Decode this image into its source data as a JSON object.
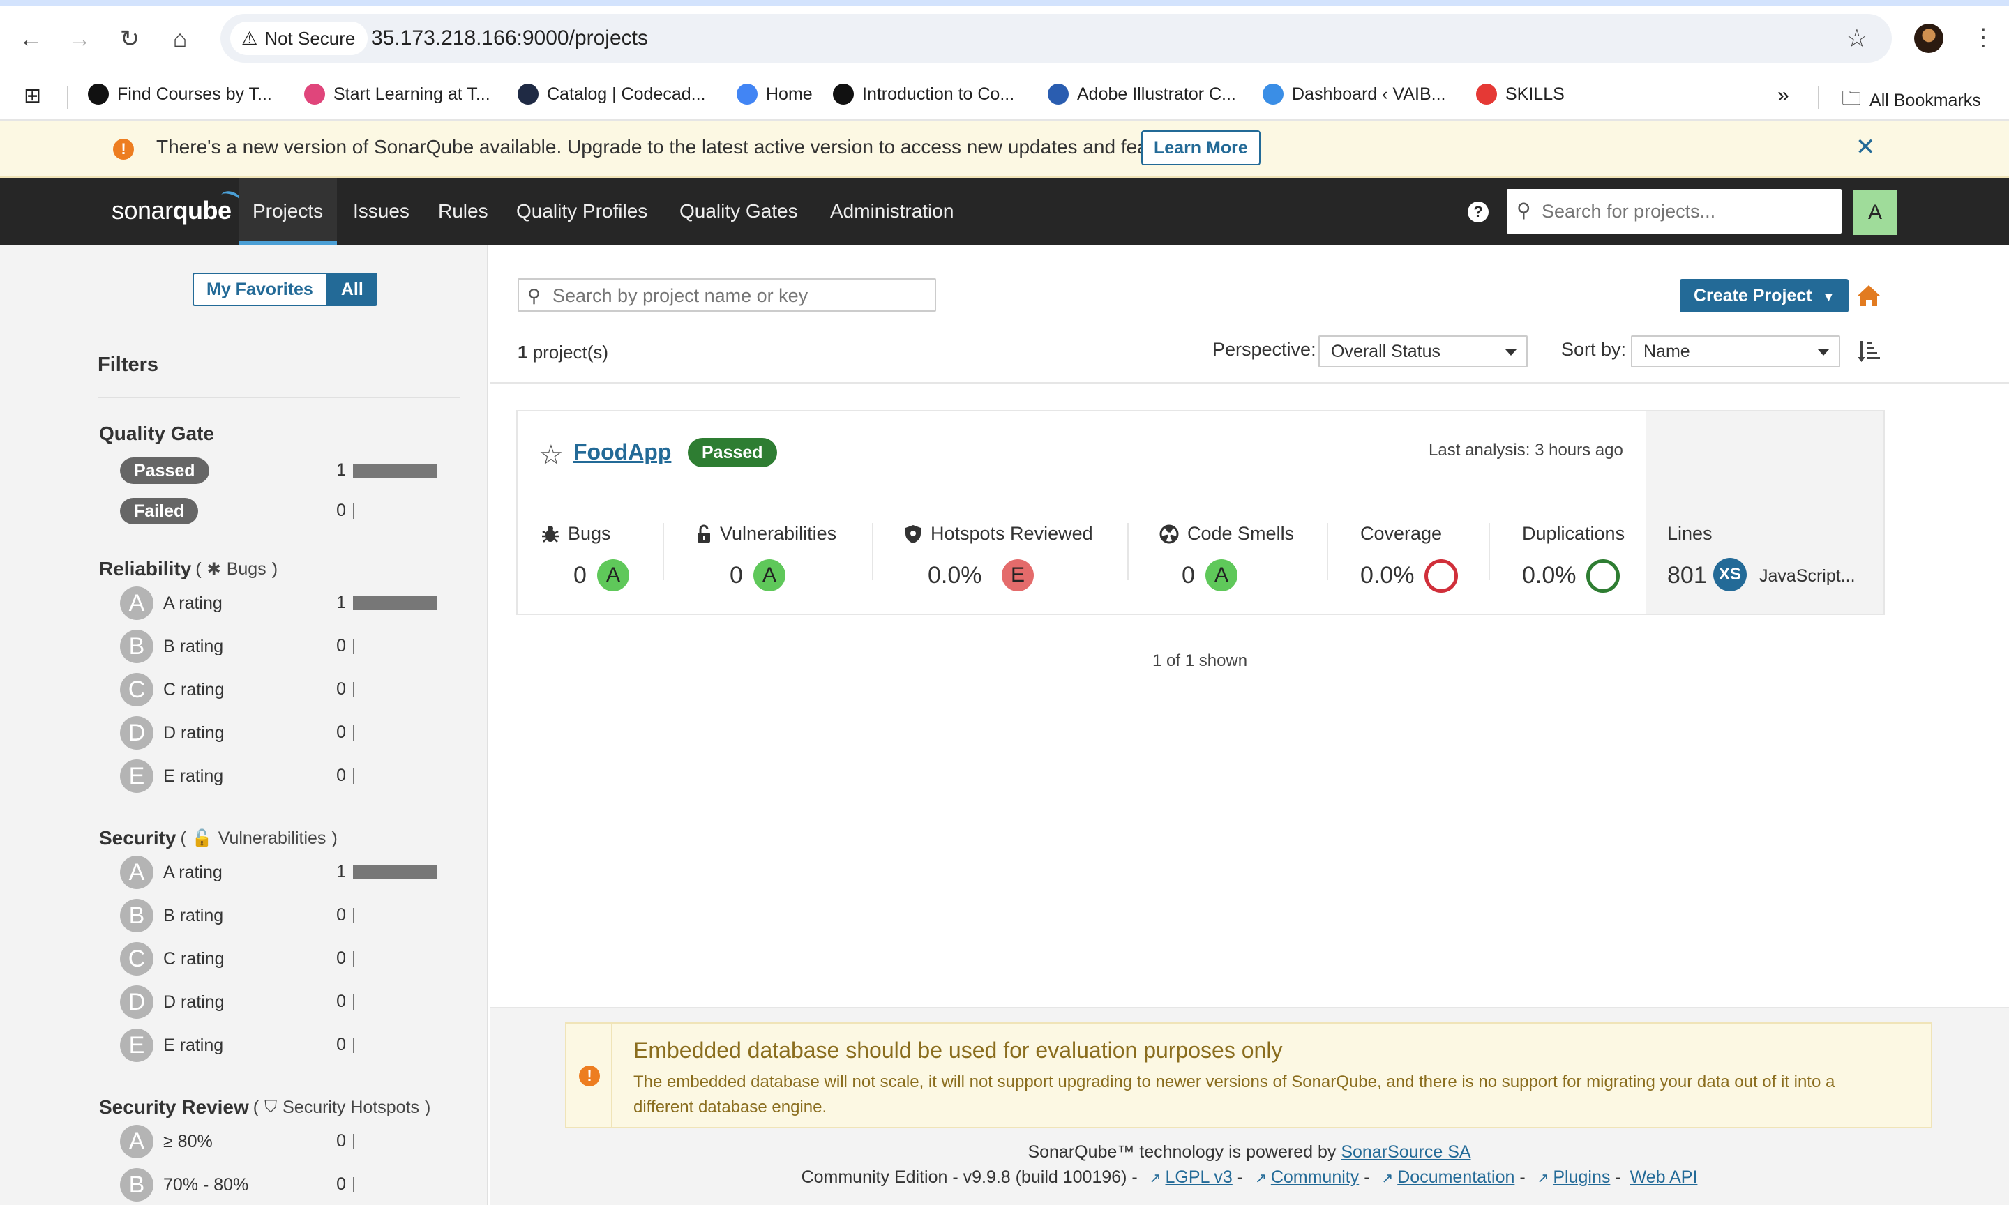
{
  "browser": {
    "security_label": "Not Secure",
    "url": "35.173.218.166:9000/projects",
    "bookmarks": [
      {
        "label": "Find Courses by T...",
        "color": "#111111"
      },
      {
        "label": "Start Learning at T...",
        "color": "#e0457b"
      },
      {
        "label": "Catalog | Codecad...",
        "color": "#1f2a44"
      },
      {
        "label": "Home",
        "color": "#4285f4"
      },
      {
        "label": "Introduction to Co...",
        "color": "#111111"
      },
      {
        "label": "Adobe Illustrator C...",
        "color": "#2a5db0"
      },
      {
        "label": "Dashboard ‹ VAIB...",
        "color": "#3a8ee6"
      },
      {
        "label": "SKILLS",
        "color": "#e53935"
      }
    ],
    "overflow_label": "»",
    "all_bookmarks_label": "All Bookmarks"
  },
  "update_banner": {
    "text": "There's a new version of SonarQube available. Upgrade to the latest active version to access new updates and features.",
    "learn_more": "Learn More"
  },
  "nav": {
    "logo_text_1": "sonar",
    "logo_text_2": "qube",
    "items": [
      "Projects",
      "Issues",
      "Rules",
      "Quality Profiles",
      "Quality Gates",
      "Administration"
    ],
    "active": "Projects",
    "search_placeholder": "Search for projects...",
    "user_initial": "A"
  },
  "sidebar": {
    "my_favorites": "My Favorites",
    "all": "All",
    "filters_title": "Filters",
    "quality_gate": {
      "title": "Quality Gate",
      "rows": [
        {
          "label": "Passed",
          "count": "1",
          "fraction": 1
        },
        {
          "label": "Failed",
          "count": "0",
          "fraction": 0
        }
      ]
    },
    "reliability": {
      "title": "Reliability",
      "sub": "Bugs",
      "rows": [
        {
          "letter": "A",
          "label": "A rating",
          "count": "1",
          "fraction": 1
        },
        {
          "letter": "B",
          "label": "B rating",
          "count": "0",
          "fraction": 0
        },
        {
          "letter": "C",
          "label": "C rating",
          "count": "0",
          "fraction": 0
        },
        {
          "letter": "D",
          "label": "D rating",
          "count": "0",
          "fraction": 0
        },
        {
          "letter": "E",
          "label": "E rating",
          "count": "0",
          "fraction": 0
        }
      ]
    },
    "security": {
      "title": "Security",
      "sub": "Vulnerabilities",
      "rows": [
        {
          "letter": "A",
          "label": "A rating",
          "count": "1",
          "fraction": 1
        },
        {
          "letter": "B",
          "label": "B rating",
          "count": "0",
          "fraction": 0
        },
        {
          "letter": "C",
          "label": "C rating",
          "count": "0",
          "fraction": 0
        },
        {
          "letter": "D",
          "label": "D rating",
          "count": "0",
          "fraction": 0
        },
        {
          "letter": "E",
          "label": "E rating",
          "count": "0",
          "fraction": 0
        }
      ]
    },
    "security_review": {
      "title": "Security Review",
      "sub": "Security Hotspots",
      "rows": [
        {
          "letter": "A",
          "label": "≥ 80%",
          "count": "0",
          "fraction": 0
        },
        {
          "letter": "B",
          "label": "70% - 80%",
          "count": "0",
          "fraction": 0
        }
      ]
    }
  },
  "main": {
    "search_placeholder": "Search by project name or key",
    "create_project": "Create Project",
    "project_count_num": "1",
    "project_count_suffix": " project(s)",
    "perspective_label": "Perspective:",
    "perspective_value": "Overall Status",
    "sortby_label": "Sort by:",
    "sortby_value": "Name",
    "shown": "1 of 1 shown"
  },
  "project": {
    "name": "FoodApp",
    "quality_gate": "Passed",
    "last_analysis": "Last analysis: 3 hours ago",
    "metrics": {
      "bugs": {
        "label": "Bugs",
        "value": "0",
        "rating": "A"
      },
      "vulnerabilities": {
        "label": "Vulnerabilities",
        "value": "0",
        "rating": "A"
      },
      "hotspots": {
        "label": "Hotspots Reviewed",
        "value": "0.0%",
        "rating": "E"
      },
      "code_smells": {
        "label": "Code Smells",
        "value": "0",
        "rating": "A"
      },
      "coverage": {
        "label": "Coverage",
        "value": "0.0%"
      },
      "duplications": {
        "label": "Duplications",
        "value": "0.0%"
      },
      "lines": {
        "label": "Lines",
        "value": "801",
        "size": "XS",
        "language": "JavaScript..."
      }
    }
  },
  "footer": {
    "warning_title": "Embedded database should be used for evaluation purposes only",
    "warning_body": "The embedded database will not scale, it will not support upgrading to newer versions of SonarQube, and there is no support for migrating your data out of it into a different database engine.",
    "powered_prefix": "SonarQube™ technology is powered by ",
    "powered_link": "SonarSource SA",
    "edition": "Community Edition - v9.9.8 (build 100196) -",
    "links": [
      "LGPL v3",
      "Community",
      "Documentation",
      "Plugins",
      "Web API"
    ]
  },
  "colors": {
    "sonar_blue": "#236a97",
    "rating_a": "#5fc85a",
    "rating_e": "#e46b6b",
    "passed_green": "#2e7d32",
    "nav_dark": "#262626"
  }
}
